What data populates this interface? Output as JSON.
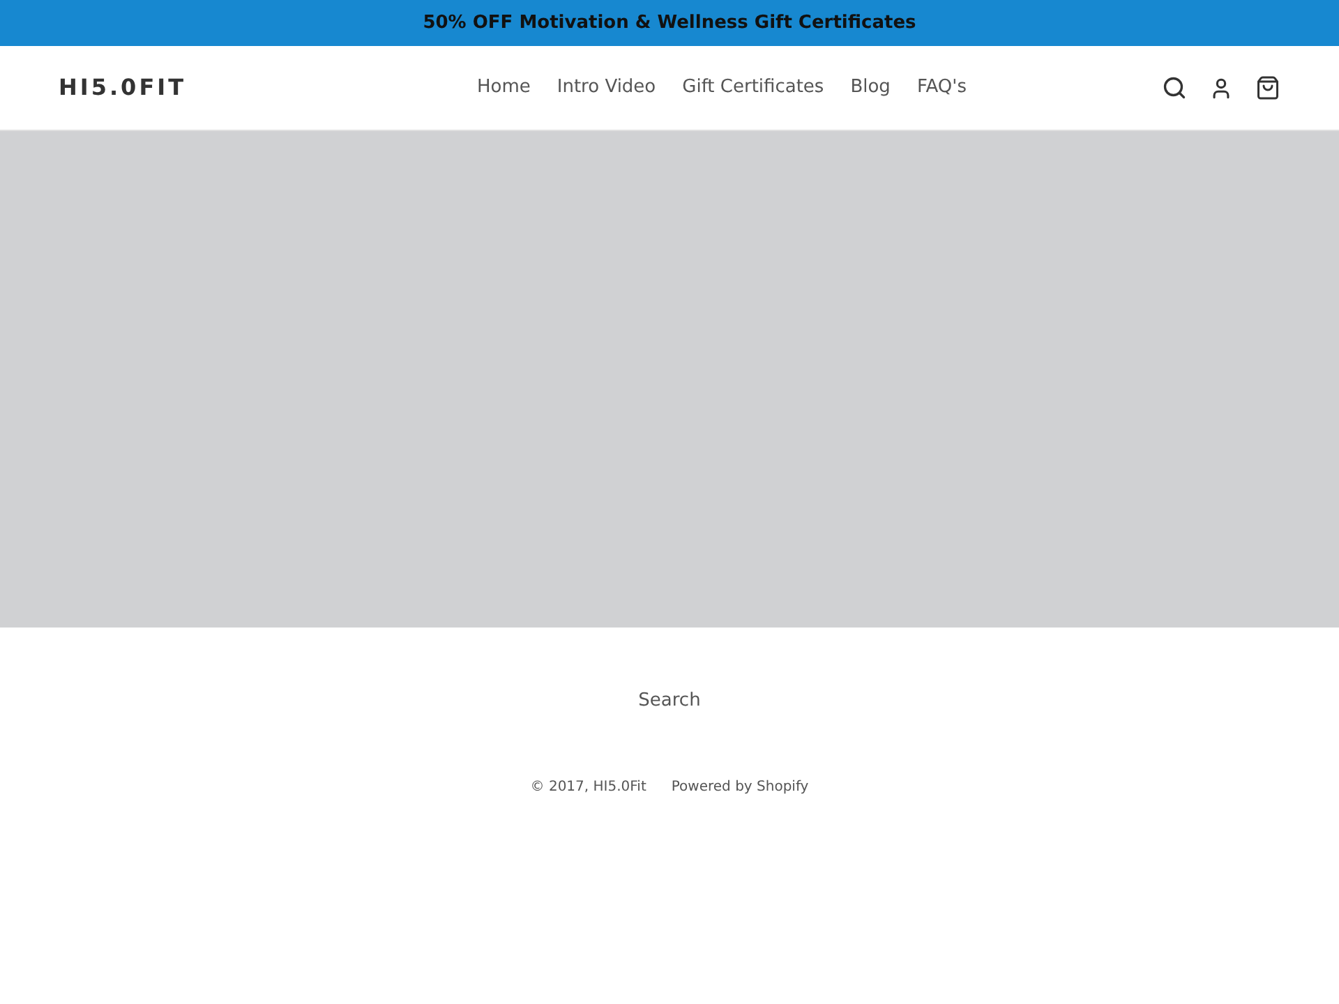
{
  "announcement": "50% OFF Motivation & Wellness Gift Certificates",
  "header": {
    "logo": "HI5.0FIT",
    "nav": [
      {
        "label": "Home"
      },
      {
        "label": "Intro Video"
      },
      {
        "label": "Gift Certificates"
      },
      {
        "label": "Blog"
      },
      {
        "label": "FAQ's"
      }
    ]
  },
  "footer": {
    "links": [
      "Search"
    ],
    "copyright": "© 2017, HI5.0Fit",
    "powered_by": "Powered by Shopify"
  }
}
